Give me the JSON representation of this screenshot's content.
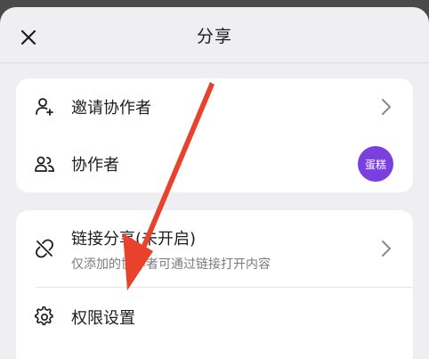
{
  "header": {
    "title": "分享",
    "close_icon": "close-icon"
  },
  "collab_card": {
    "invite": {
      "label": "邀请协作者",
      "icon": "person-add-icon"
    },
    "collaborators": {
      "label": "协作者",
      "icon": "people-icon",
      "avatar_text": "蛋糕"
    }
  },
  "share_card": {
    "link_share": {
      "label": "链接分享(未开启)",
      "sublabel": "仅添加的协作者可通过链接打开内容",
      "icon": "link-off-icon"
    },
    "permissions": {
      "label": "权限设置",
      "icon": "gear-icon"
    }
  },
  "colors": {
    "avatar": "#7b3fe0",
    "annotation_arrow": "#e8412c"
  }
}
